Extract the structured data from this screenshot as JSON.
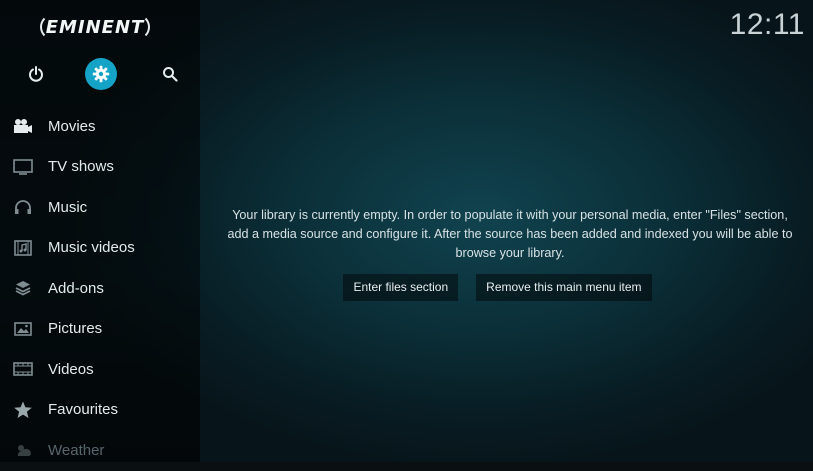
{
  "app": {
    "logo_text": "EMINENT",
    "clock": "12:11",
    "accent_color": "#14a3c7"
  },
  "top_icons": [
    "power-icon",
    "settings-icon",
    "search-icon"
  ],
  "menu": {
    "items": [
      {
        "label": "Movies",
        "icon": "movies-icon"
      },
      {
        "label": "TV shows",
        "icon": "tv-icon"
      },
      {
        "label": "Music",
        "icon": "headphones-icon"
      },
      {
        "label": "Music videos",
        "icon": "music-video-icon"
      },
      {
        "label": "Add-ons",
        "icon": "addons-icon"
      },
      {
        "label": "Pictures",
        "icon": "pictures-icon"
      },
      {
        "label": "Videos",
        "icon": "videos-icon"
      },
      {
        "label": "Favourites",
        "icon": "star-icon"
      },
      {
        "label": "Weather",
        "icon": "weather-icon"
      }
    ]
  },
  "main": {
    "message": "Your library is currently empty. In order to populate it with your personal media, enter \"Files\" section, add a media source and configure it. After the source has been added and indexed you will be able to browse your library.",
    "buttons": {
      "enter_files": "Enter files section",
      "remove_item": "Remove this main menu item"
    }
  }
}
